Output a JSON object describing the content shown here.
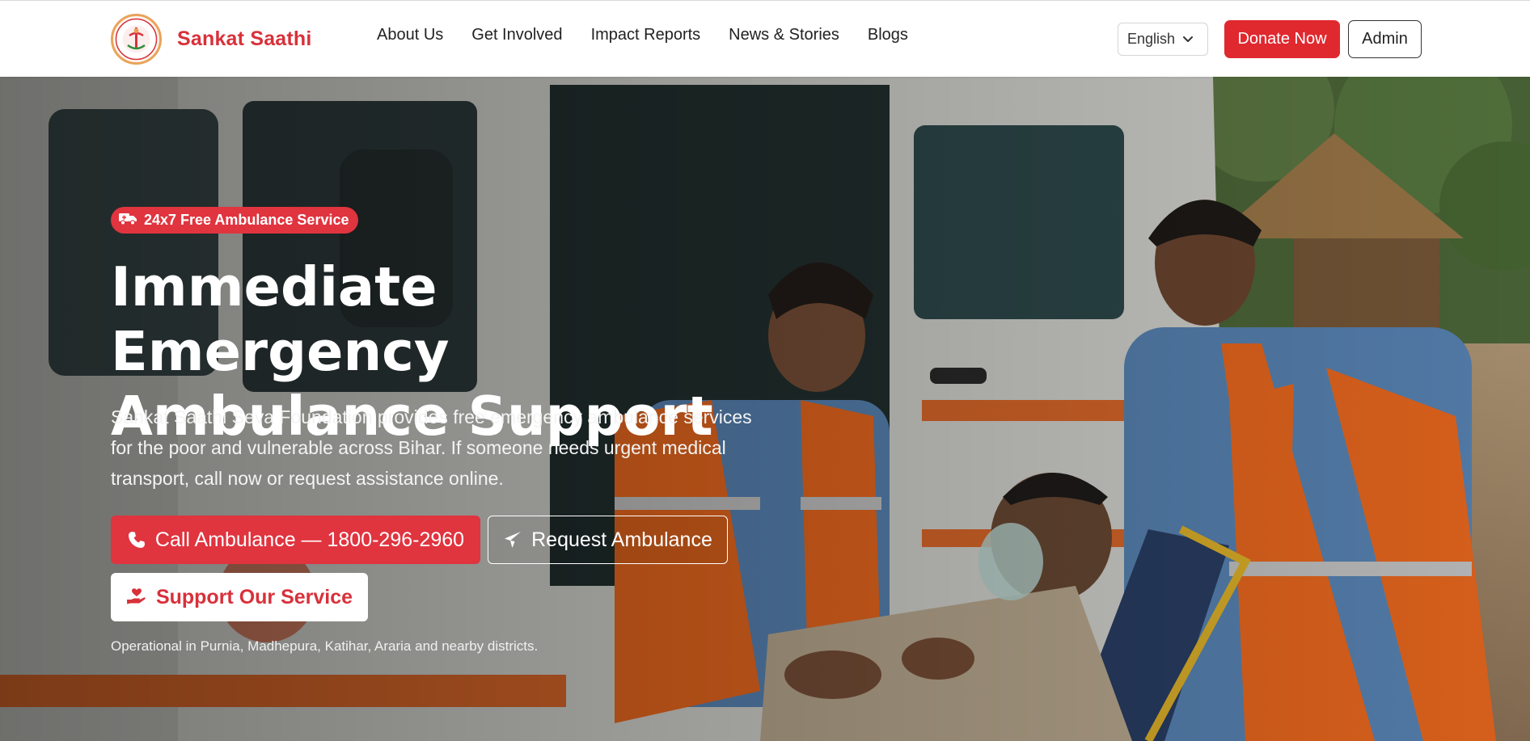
{
  "brand": {
    "name": "Sankat Saathi",
    "logo_icon": "logo-emblem",
    "accent": "#e0282f"
  },
  "nav": {
    "links": [
      "About Us",
      "Get Involved",
      "Impact Reports",
      "News & Stories",
      "Blogs"
    ],
    "language": {
      "selected": "English",
      "icon": "chevron-down-icon"
    },
    "donate_label": "Donate Now",
    "admin_label": "Admin"
  },
  "hero": {
    "badge": "24x7 Free Ambulance Service",
    "title_line1": "Immediate Emergency",
    "title_line2": "Ambulance Support",
    "description": "Sankat Saathi Seva Foundation provides free emergency ambulance services for the poor and vulnerable across Bihar. If someone needs urgent medical transport, call now or request assistance online.",
    "call_label": "Call Ambulance — 1800-296-2960",
    "request_label": "Request Ambulance",
    "support_label": "Support Our Service",
    "note": "Operational in Purnia, Madhepura, Katihar, Araria and nearby districts."
  },
  "colors": {
    "primary": "#e0343f",
    "text_dark": "#222222",
    "white": "#ffffff"
  }
}
